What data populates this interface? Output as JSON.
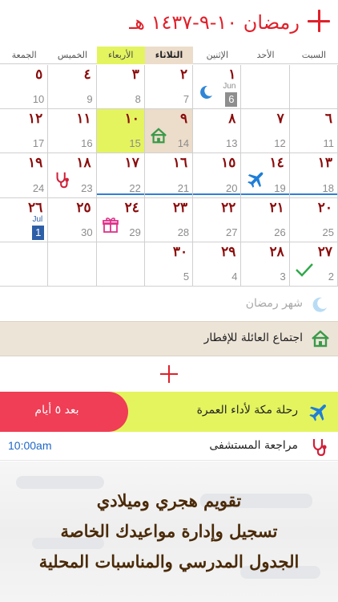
{
  "header": {
    "title": "رمضان ١٠-٩-١٤٣٧ هـ",
    "add_icon": "plus-icon"
  },
  "weekdays": [
    "السبت",
    "الأحد",
    "الإثنين",
    "الثلاثاء",
    "الأربعاء",
    "الخميس",
    "الجمعة"
  ],
  "colors": {
    "accent_red": "#e0202a",
    "hijri_number": "#8a0b0b",
    "today_yellow": "#e4f45f",
    "selected_beige": "#ecdcca",
    "alert_pink": "#ef3e56",
    "time_blue": "#1f67c6"
  },
  "grid": {
    "rows": [
      [
        {
          "h": "",
          "g": ""
        },
        {
          "h": "",
          "g": ""
        },
        {
          "h": "١",
          "g": "6",
          "month": "Jun",
          "gbox": "grey",
          "icon": "moon-icon"
        },
        {
          "h": "٢",
          "g": "7"
        },
        {
          "h": "٣",
          "g": "8"
        },
        {
          "h": "٤",
          "g": "9"
        },
        {
          "h": "٥",
          "g": "10"
        }
      ],
      [
        {
          "h": "٦",
          "g": "11"
        },
        {
          "h": "٧",
          "g": "12"
        },
        {
          "h": "٨",
          "g": "13"
        },
        {
          "h": "٩",
          "g": "14",
          "icon": "home-icon",
          "sel": true
        },
        {
          "h": "١٠",
          "g": "15",
          "today": true
        },
        {
          "h": "١١",
          "g": "16"
        },
        {
          "h": "١٢",
          "g": "17"
        }
      ],
      [
        {
          "h": "١٣",
          "g": "18"
        },
        {
          "h": "١٤",
          "g": "19",
          "icon": "airplane-icon"
        },
        {
          "h": "١٥",
          "g": "20"
        },
        {
          "h": "١٦",
          "g": "21"
        },
        {
          "h": "١٧",
          "g": "22"
        },
        {
          "h": "١٨",
          "g": "23",
          "icon": "stethoscope-icon"
        },
        {
          "h": "١٩",
          "g": "24"
        }
      ],
      [
        {
          "h": "٢٠",
          "g": "25"
        },
        {
          "h": "٢١",
          "g": "26"
        },
        {
          "h": "٢٢",
          "g": "27"
        },
        {
          "h": "٢٣",
          "g": "28"
        },
        {
          "h": "٢٤",
          "g": "29",
          "icon": "gift-icon"
        },
        {
          "h": "٢٥",
          "g": "30"
        },
        {
          "h": "٢٦",
          "g": "1",
          "month": "Jul",
          "gbox": "blue"
        }
      ],
      [
        {
          "h": "٢٧",
          "g": "2",
          "icon": "checkmark-icon"
        },
        {
          "h": "٢٨",
          "g": "3"
        },
        {
          "h": "٢٩",
          "g": "4"
        },
        {
          "h": "٣٠",
          "g": "5"
        },
        {
          "h": "",
          "g": ""
        },
        {
          "h": "",
          "g": ""
        },
        {
          "h": "",
          "g": ""
        }
      ]
    ]
  },
  "events": {
    "month_label": "شهر رمضان",
    "family": "اجتماع العائلة للإفطار",
    "trip": "رحلة مكة لأداء العمرة",
    "trip_countdown": "بعد ٥ أيام",
    "hospital": "مراجعة المستشفى",
    "hospital_time": "10:00am"
  },
  "promo": {
    "line1": "تقويم هجري وميلادي",
    "line2": "تسجيل وإدارة مواعيدك الخاصة",
    "line3": "الجدول المدرسي والمناسبات المحلية"
  }
}
